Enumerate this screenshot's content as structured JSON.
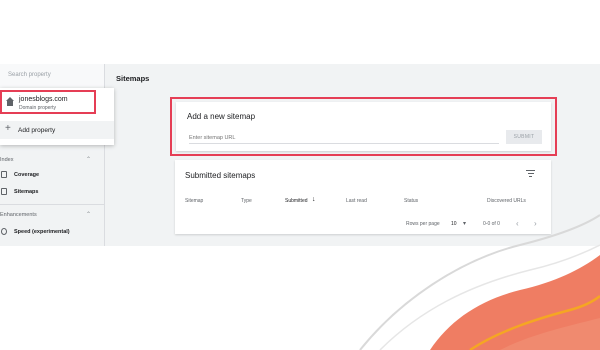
{
  "sidebar": {
    "search_placeholder": "Search property",
    "section_index": "Index",
    "section_enhancements": "Enhancements",
    "items": [
      {
        "label": "Coverage",
        "icon": "page-icon"
      },
      {
        "label": "Sitemaps",
        "icon": "sitemap-icon"
      },
      {
        "label": "Speed (experimental)",
        "icon": "speed-icon"
      }
    ]
  },
  "property_dropdown": {
    "property_name": "jonesblogs.com",
    "property_type": "Domain property",
    "add_property_label": "Add property"
  },
  "main": {
    "page_title": "Sitemaps",
    "add_card": {
      "title": "Add a new sitemap",
      "input_placeholder": "Enter sitemap URL",
      "submit_label": "SUBMIT"
    },
    "submitted_card": {
      "title": "Submitted sitemaps",
      "columns": [
        "Sitemap",
        "Type",
        "Submitted",
        "Last read",
        "Status",
        "Discovered URLs"
      ],
      "sort_indicator": "↓",
      "rows_per_page_label": "Rows per page",
      "rows_per_page_value": "10",
      "range_label": "0-0 of 0"
    }
  },
  "colors": {
    "highlight": "#e53e55",
    "wave_orange": "#ef7d63",
    "wave_yellow": "#f5a623"
  }
}
